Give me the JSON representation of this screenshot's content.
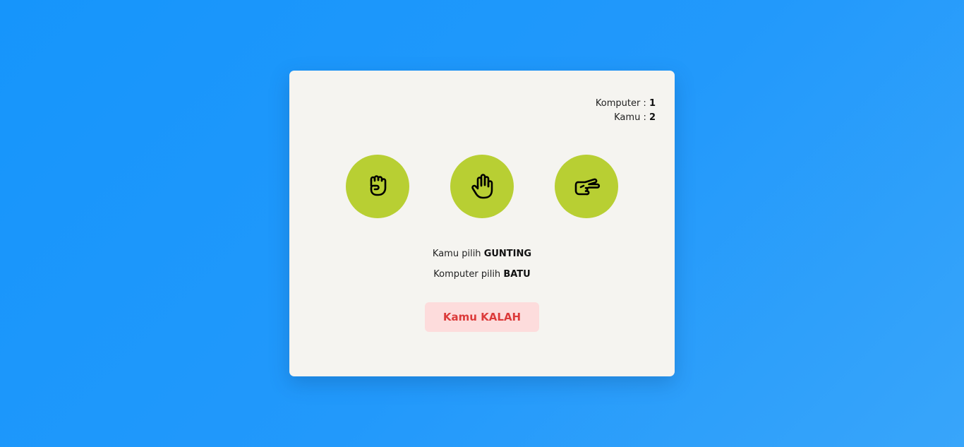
{
  "score": {
    "computer_label": "Komputer : ",
    "computer_value": "1",
    "player_label": "Kamu : ",
    "player_value": "2"
  },
  "choices": [
    {
      "id": "batu",
      "icon": "fist-rock-icon"
    },
    {
      "id": "kertas",
      "icon": "open-hand-paper-icon"
    },
    {
      "id": "gunting",
      "icon": "scissors-hand-icon"
    }
  ],
  "picks": {
    "player_prefix": "Kamu pilih ",
    "player_choice": "GUNTING",
    "computer_prefix": "Komputer pilih ",
    "computer_choice": "BATU"
  },
  "result": {
    "text": "Kamu KALAH"
  },
  "colors": {
    "background": "#1e97fb",
    "card": "#f5f4f0",
    "choice_circle": "#b8cf33",
    "result_bg": "#fddcdc",
    "result_text": "#dc3b3b"
  }
}
